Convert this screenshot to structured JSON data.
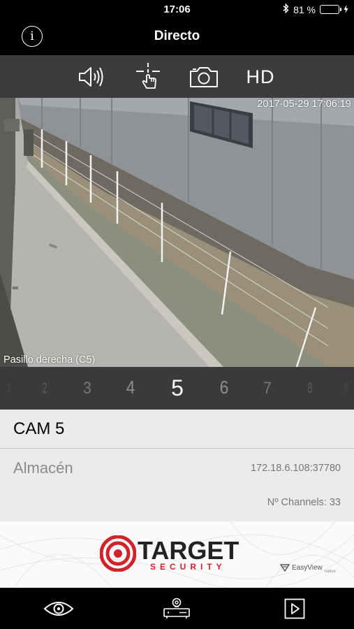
{
  "status": {
    "time": "17:06",
    "battery_percent": "81 %",
    "battery_level": 0.81
  },
  "nav": {
    "title": "Directo",
    "info_glyph": "i"
  },
  "toolbar": {
    "icons": [
      "speaker-icon",
      "ptz-touch-icon",
      "camera-icon"
    ],
    "quality_label": "HD"
  },
  "video": {
    "timestamp": "2017-05-29 17:06:19",
    "camera_label": "Pasillo derecha (C5)"
  },
  "channels": {
    "items": [
      "1",
      "2",
      "3",
      "4",
      "5",
      "6",
      "7",
      "8",
      "9"
    ],
    "selected": "5"
  },
  "camera": {
    "title": "CAM 5",
    "location": "Almacén",
    "address": "172.18.6.108:37780",
    "channels_count": "Nº Channels: 33"
  },
  "banner": {
    "brand": "TARGET",
    "brand_sub": "SECURITY",
    "partner": "EasyView",
    "partner_sub": "native",
    "accent": "#d2232a"
  },
  "tabs": [
    "eye-icon",
    "dvr-icon",
    "play-icon"
  ]
}
